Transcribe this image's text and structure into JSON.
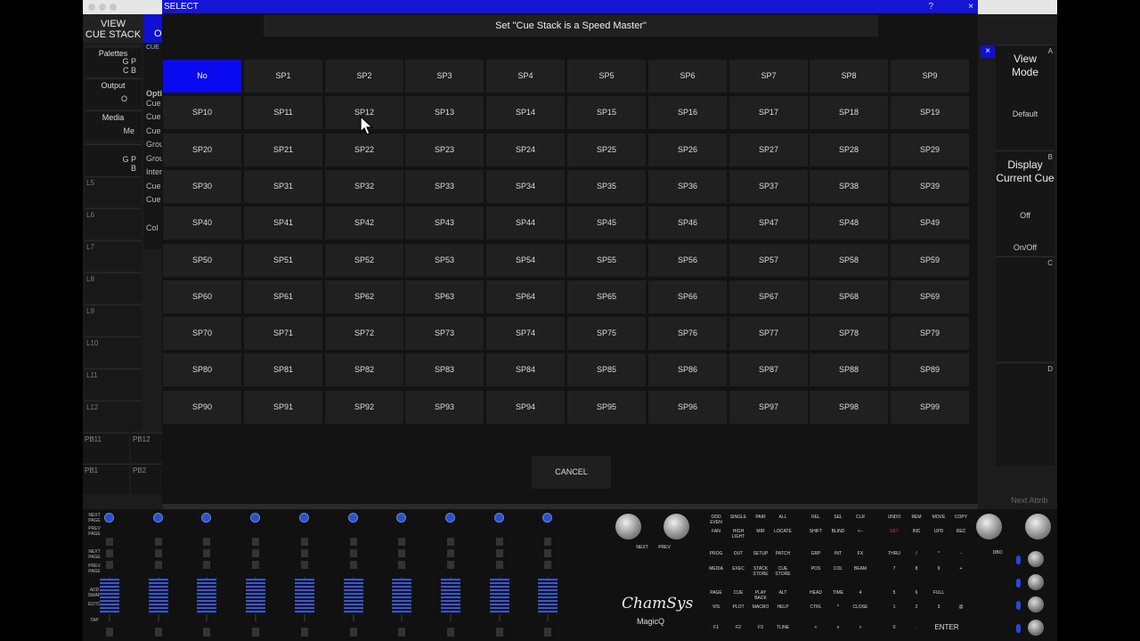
{
  "dialog": {
    "title": "SELECT",
    "help": "?",
    "close": "×",
    "prompt": "Set \"Cue Stack is a Speed Master\"",
    "selected": "No",
    "options": [
      "No",
      "SP1",
      "SP2",
      "SP3",
      "SP4",
      "SP5",
      "SP6",
      "SP7",
      "SP8",
      "SP9",
      "SP10",
      "SP11",
      "SP12",
      "SP13",
      "SP14",
      "SP15",
      "SP16",
      "SP17",
      "SP18",
      "SP19",
      "SP20",
      "SP21",
      "SP22",
      "SP23",
      "SP24",
      "SP25",
      "SP26",
      "SP27",
      "SP28",
      "SP29",
      "SP30",
      "SP31",
      "SP32",
      "SP33",
      "SP34",
      "SP35",
      "SP36",
      "SP37",
      "SP38",
      "SP39",
      "SP40",
      "SP41",
      "SP42",
      "SP43",
      "SP44",
      "SP45",
      "SP46",
      "SP47",
      "SP48",
      "SP49",
      "SP50",
      "SP51",
      "SP52",
      "SP53",
      "SP54",
      "SP55",
      "SP56",
      "SP57",
      "SP58",
      "SP59",
      "SP60",
      "SP61",
      "SP62",
      "SP63",
      "SP64",
      "SP65",
      "SP66",
      "SP67",
      "SP68",
      "SP69",
      "SP70",
      "SP71",
      "SP72",
      "SP73",
      "SP74",
      "SP75",
      "SP76",
      "SP77",
      "SP78",
      "SP79",
      "SP80",
      "SP81",
      "SP82",
      "SP83",
      "SP84",
      "SP85",
      "SP86",
      "SP87",
      "SP88",
      "SP89",
      "SP90",
      "SP91",
      "SP92",
      "SP93",
      "SP94",
      "SP95",
      "SP96",
      "SP97",
      "SP98",
      "SP99"
    ],
    "cancel": "CANCEL"
  },
  "left_panel": {
    "view_title": "VIEW\nCUE STACK",
    "options_tab": "O",
    "cue_tab": "CUE",
    "palettes": {
      "label": "Palettes",
      "sub": "G P\nC B"
    },
    "output": {
      "label": "Output",
      "sub": "O"
    },
    "media": {
      "label": "Media",
      "sub": "Me"
    },
    "gp": "G P\nB",
    "rows": [
      "L5",
      "L6",
      "L7",
      "L8",
      "L9",
      "L10",
      "L11",
      "L12"
    ],
    "cue_column": [
      "Opti",
      "Cue",
      "Cue",
      "Cue",
      "Grou",
      "Grou",
      "Inter",
      "Cue",
      "Cue",
      "",
      "Col"
    ],
    "playbacks": [
      "PB11",
      "PB12",
      "PB1",
      "PB2"
    ]
  },
  "right_panel": {
    "view_mode": {
      "title": "View\nMode",
      "value": "Default",
      "letter": "A"
    },
    "display": {
      "title": "Display\nCurrent Cue",
      "value": "Off",
      "toggle": "On/Off",
      "letter": "B"
    },
    "c": {
      "letter": "C"
    },
    "d": {
      "letter": "D"
    },
    "next_attrib": "Next Attrib"
  },
  "console": {
    "side_labels": [
      "NEXT PAGE",
      "PREV PAGE",
      "NEXT PAGE",
      "PREV PAGE",
      "ADD SWAP",
      "GOTO",
      "TAP"
    ],
    "fader_count": 10,
    "logo": "ChamSys",
    "logo_sub": "MagicQ",
    "nav_keys": [
      "NEXT",
      "PREV"
    ],
    "keys": [
      "ODD EVEN",
      "SINGLE",
      "PAIR",
      "ALL",
      "REL",
      "SEL",
      "CLR",
      "UNDO",
      "REM",
      "MOVE",
      "COPY",
      "FAN",
      "HIGH LIGHT",
      "MIR",
      "LOCATE",
      "SHIFT",
      "BLIND",
      "<--",
      "SET",
      "INC",
      "UPD",
      "REC",
      "PROG",
      "OUT",
      "SETUP",
      "PATCH",
      "GRP",
      "INT",
      "FX",
      "THRU",
      "/",
      "*",
      "-",
      "MEDIA",
      "EXEC",
      "STACK STORE",
      "CUE STORE",
      "POS",
      "COL",
      "BEAM",
      "7",
      "8",
      "9",
      "+",
      "PAGE",
      "CUE",
      "PLAY BACK",
      "ALT",
      "HEAD",
      "TIME",
      "4",
      "5",
      "6",
      "FULL",
      "VIS",
      "PLOT",
      "MACRO",
      "HELP",
      "CTRL",
      "^",
      "CLOSE",
      "1",
      "2",
      "3",
      "@",
      "F1",
      "F2",
      "F3",
      "TLINE",
      "<",
      "v",
      ">",
      "0",
      ".",
      "ENTER"
    ],
    "dbo": "DBO",
    "accent": "#2448e0"
  }
}
